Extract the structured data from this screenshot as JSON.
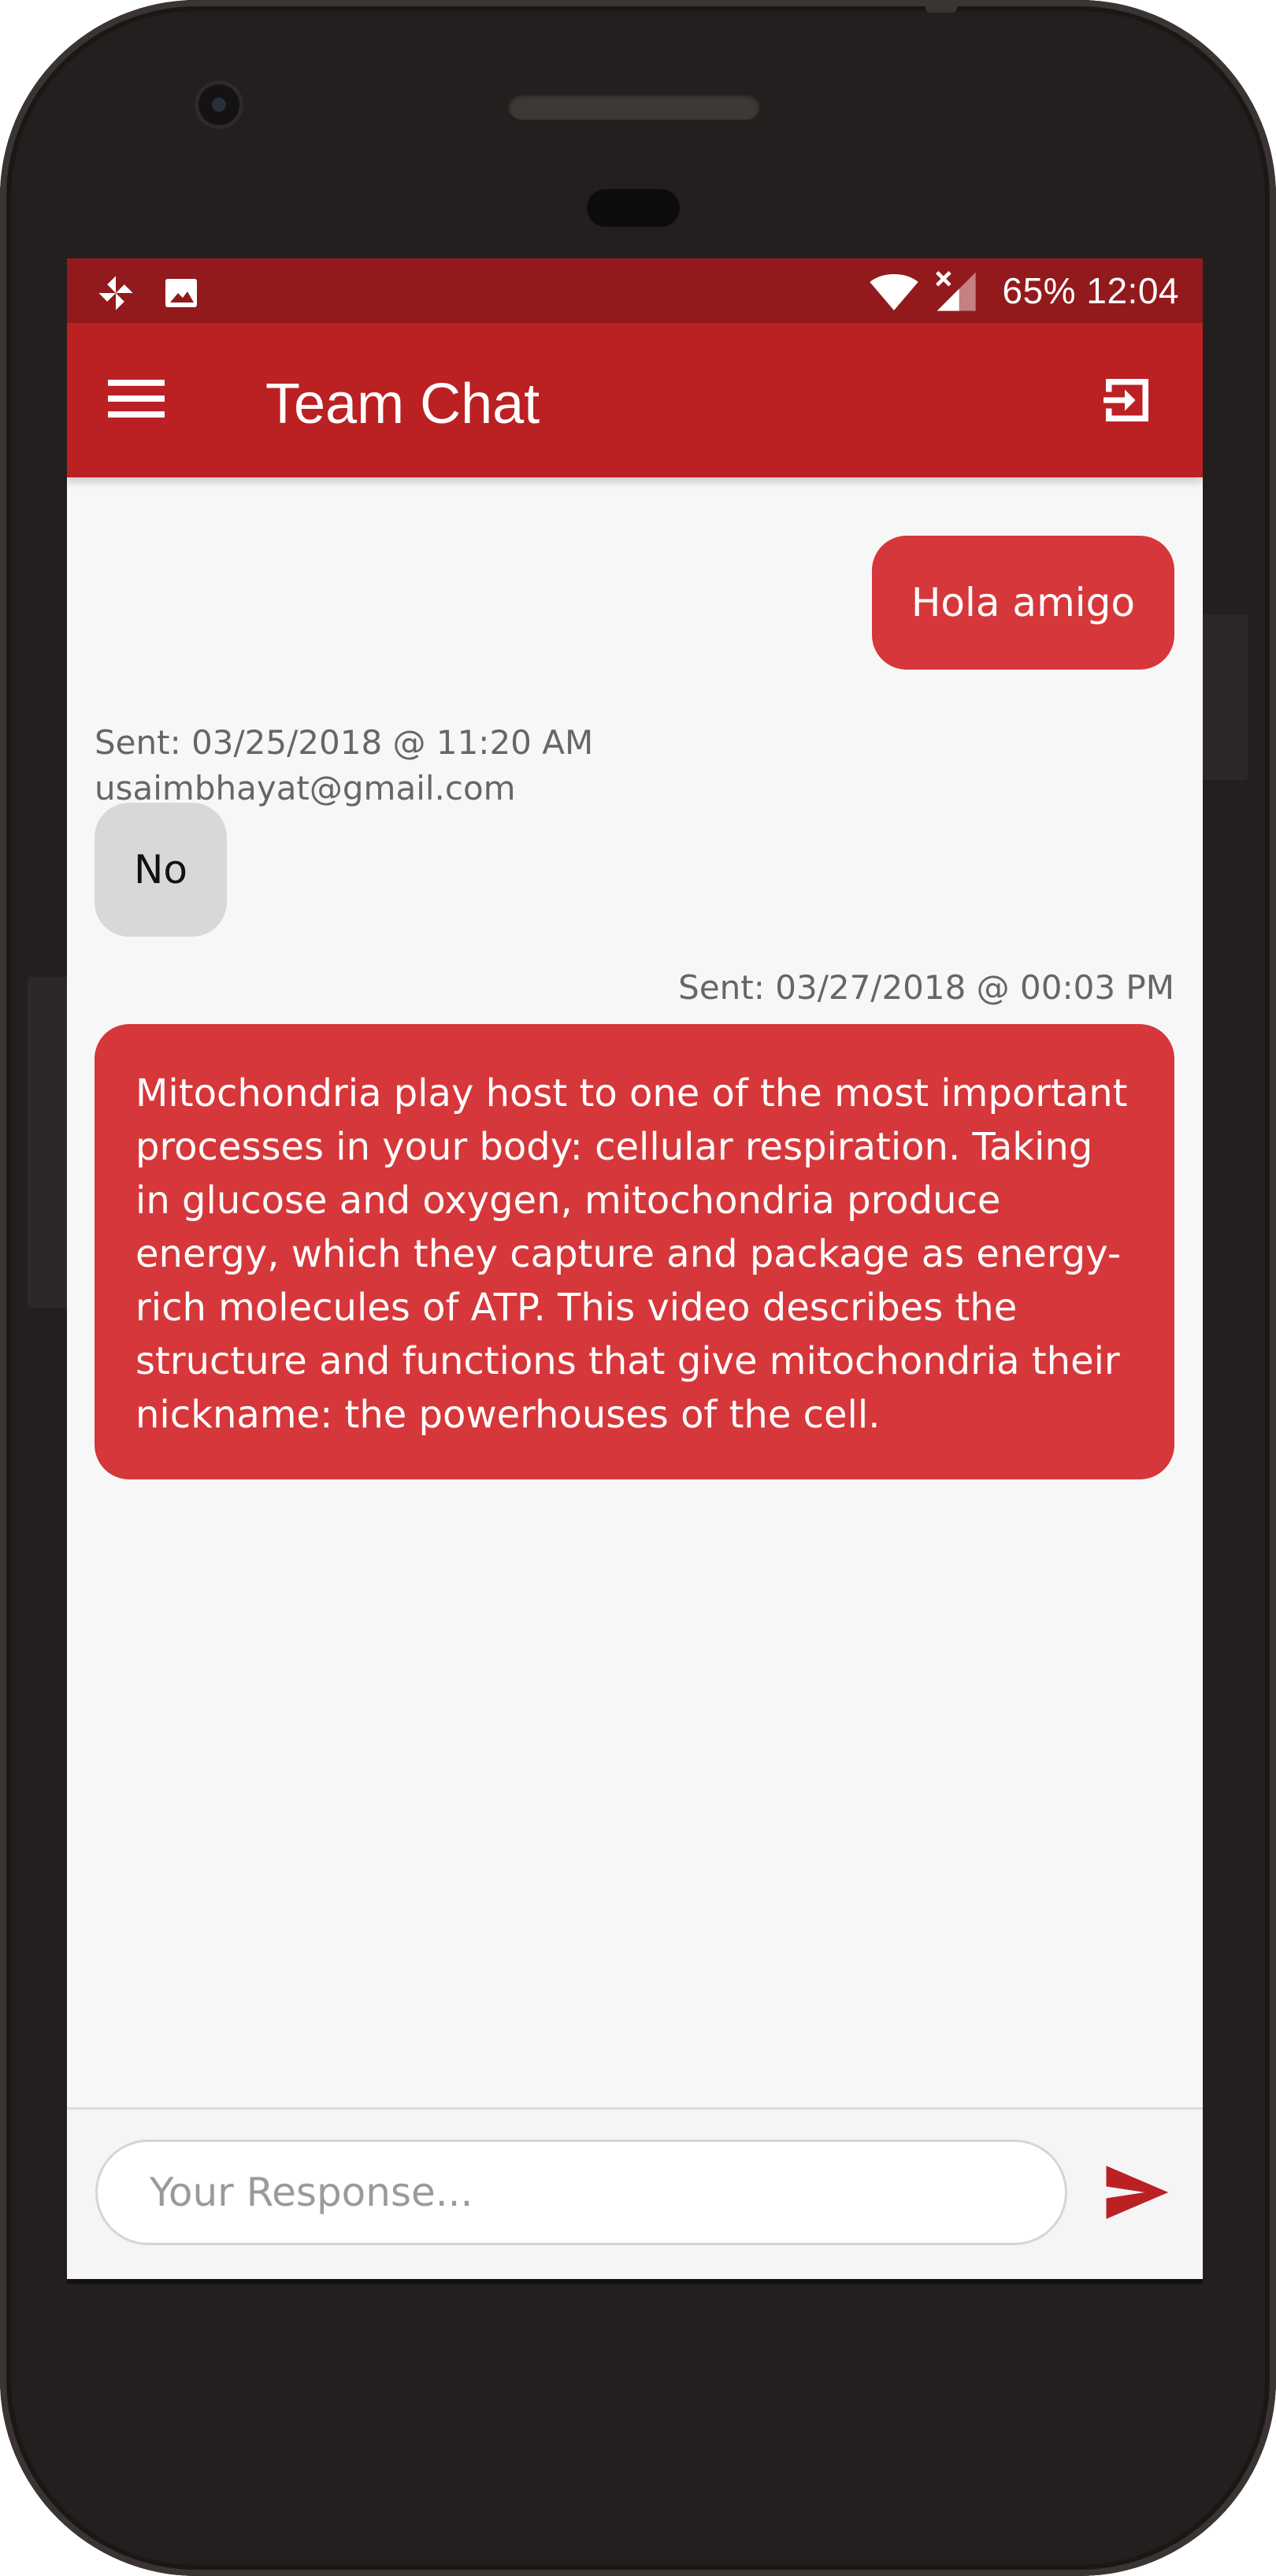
{
  "status_bar": {
    "battery": "65%",
    "time": "12:04",
    "left_icons": [
      "pinwheel-icon",
      "image-icon"
    ],
    "right_icons": [
      "wifi-icon",
      "signal-icon"
    ]
  },
  "app_bar": {
    "title": "Team Chat",
    "menu_icon": "hamburger-menu-icon",
    "action_icon": "logout-icon"
  },
  "messages": [
    {
      "direction": "sent",
      "text": "Hola amigo"
    },
    {
      "direction": "received",
      "meta": "Sent: 03/25/2018 @ 11:20 AM",
      "sender": "usaimbhayat@gmail.com",
      "text": "No"
    },
    {
      "direction": "sent",
      "meta": "Sent: 03/27/2018 @ 00:03 PM",
      "text": "Mitochondria play host to one of the most important processes in your body: cellular respiration. Taking in glucose and oxygen, mitochondria produce energy, which they capture and package as energy-rich molecules of ATP. This video describes the structure and functions that give mitochondria their nickname: the powerhouses of the cell."
    }
  ],
  "composer": {
    "placeholder": "Your Response...",
    "value": "",
    "send_icon": "send-icon"
  },
  "colors": {
    "status_bar": "#921a1c",
    "app_bar": "#bb2023",
    "sent_bubble": "#d6373a",
    "received_bubble": "#d9d8d9",
    "send_icon": "#bb2023"
  }
}
